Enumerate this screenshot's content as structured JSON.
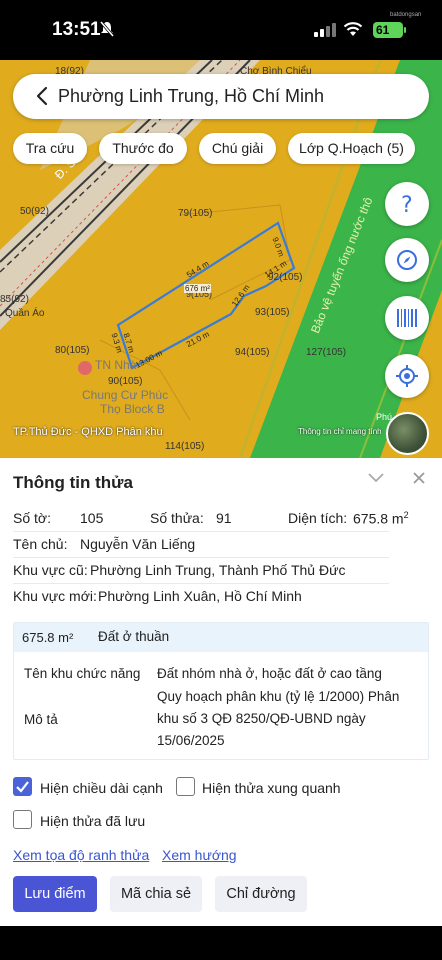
{
  "status": {
    "time": "13:51",
    "battery": "61",
    "watermark": "batdongsan"
  },
  "search": {
    "text": "Phường Linh Trung, Hồ Chí Minh"
  },
  "chips": [
    "Tra cứu",
    "Thước đo",
    "Chú giải",
    "Lớp Q.Hoạch (5)"
  ],
  "map": {
    "labels": {
      "road_name": "Đ. Số 8",
      "corridor": "Bảo vệ tuyến ống nước thô",
      "area": "676 m²",
      "edge_top": "54.4 m",
      "edge_right_top": "9.0 m",
      "edge_right_mid": "14.1 m",
      "edge_right_low": "12.6 m",
      "edge_bottom_right": "21.0 m",
      "edge_bottom_left": "13.00 m",
      "edge_left_a": "9.3 m",
      "edge_left_b": "8.7 m",
      "p1": "18(92)",
      "p2": "50(92)",
      "p3": "79(105)",
      "p4": "92(105)",
      "p5": "93(105)",
      "p6": "94(105)",
      "p7": "127(105)",
      "p8": "80(105)",
      "p9": "90(105)",
      "p10": "114(105)",
      "p11": "9(105)",
      "p12": "85(92)",
      "p13": "Quần Áo",
      "p14": "Chợ Bình Chiểu",
      "poi1": "TN Nhà",
      "poi2": "Chung Cư Phúc",
      "poi3": "Thọ Block B",
      "p15": "Phú"
    },
    "caption": "TP.Thủ Đức - QHXD Phân khu",
    "notice": "Thông tin chỉ mang tính"
  },
  "panel": {
    "title": "Thông tin thửa",
    "so_to_label": "Số tờ:",
    "so_to_value": "105",
    "so_thua_label": "Số thửa:",
    "so_thua_value": "91",
    "dien_tich_label": "Diện tích:",
    "dien_tich_value": "675.8 m",
    "dien_tich_sup": "2",
    "ten_chu_label": "Tên chủ:",
    "ten_chu_value": "Nguyễn Văn Liếng",
    "kv_cu_label": "Khu vực cũ:",
    "kv_cu_value": "Phường Linh Trung, Thành Phố Thủ Đức",
    "kv_moi_label": "Khu vực mới:",
    "kv_moi_value": "Phường Linh Xuân, Hồ Chí Minh"
  },
  "info": {
    "area": "675.8 m²",
    "land_type": "Đất ở thuần",
    "func_label": "Tên khu chức năng",
    "func_value": "Đất nhóm nhà ở, hoặc đất ở cao tầng",
    "desc_label": "Mô tả",
    "desc_line1": "Quy hoạch phân khu (tỷ lệ 1/2000) Phân",
    "desc_line2": "khu số 3 QĐ 8250/QĐ-UBND ngày",
    "desc_line3": "15/06/2025"
  },
  "options": {
    "edge_length": {
      "label": "Hiện chiều dài cạnh",
      "checked": true
    },
    "surrounding": {
      "label": "Hiện thửa xung quanh",
      "checked": false
    },
    "saved": {
      "label": "Hiện thửa đã lưu",
      "checked": false
    }
  },
  "links": {
    "coords": "Xem tọa độ ranh thửa",
    "direction": "Xem hướng"
  },
  "buttons": {
    "save": "Lưu điểm",
    "share": "Mã chia sẻ",
    "route": "Chỉ đường"
  },
  "colors": {
    "map_yellow": "#e0ac1e",
    "map_green": "#3bb54a",
    "accent": "#4a55d6",
    "link": "#3a55d0"
  }
}
